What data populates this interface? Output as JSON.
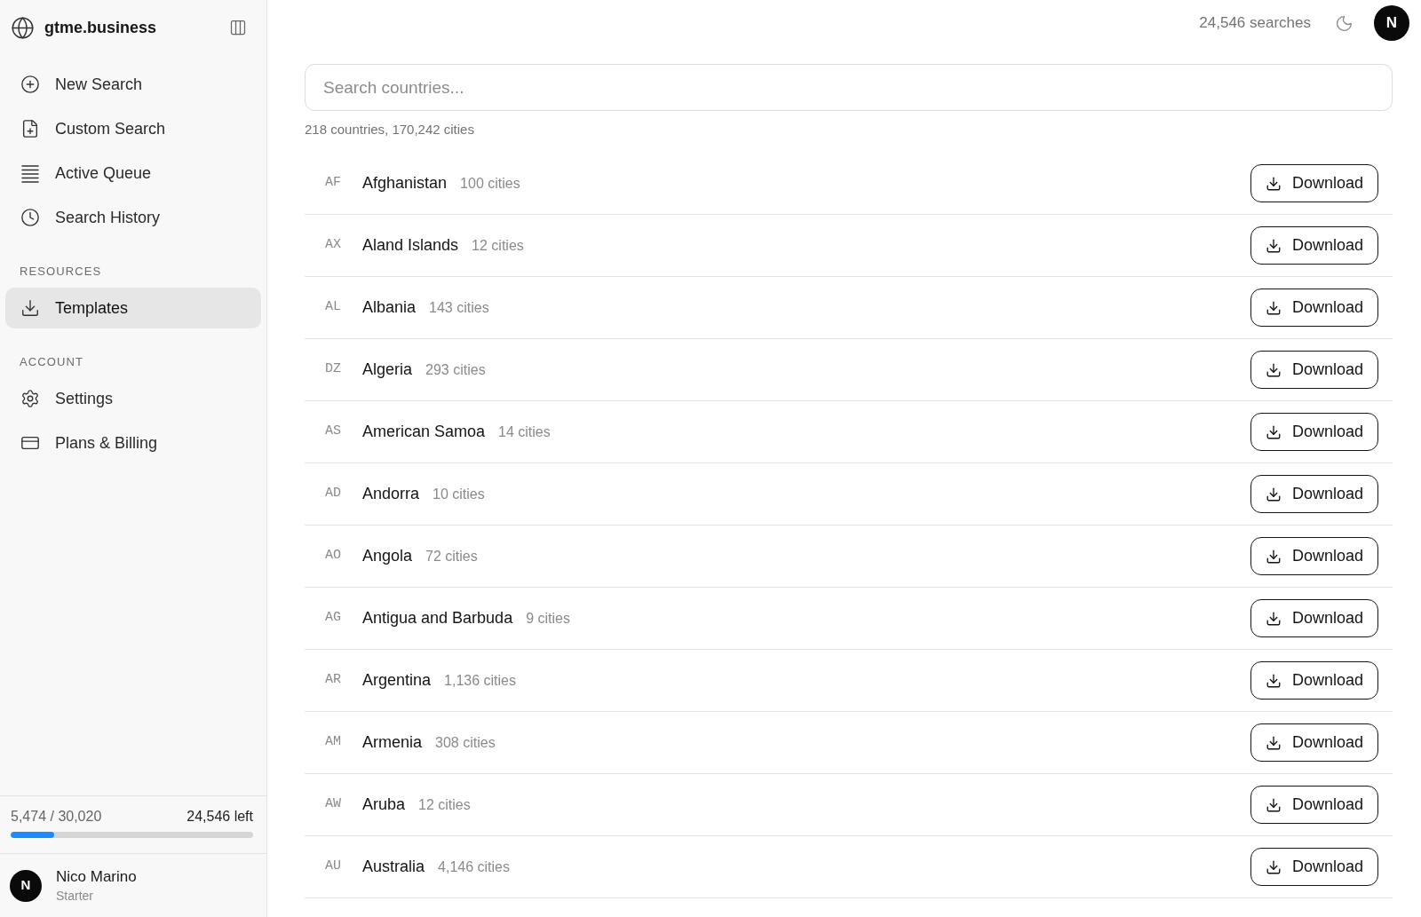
{
  "sidebar": {
    "brand": "gtme.business",
    "sections": [
      {
        "items": [
          {
            "label": "New Search",
            "selected": false
          },
          {
            "label": "Custom Search",
            "selected": false
          },
          {
            "label": "Active Queue",
            "selected": false
          },
          {
            "label": "Search History",
            "selected": false
          }
        ]
      },
      {
        "heading": "RESOURCES",
        "items": [
          {
            "label": "Templates",
            "selected": true
          }
        ]
      },
      {
        "heading": "ACCOUNT",
        "items": [
          {
            "label": "Settings",
            "selected": false
          },
          {
            "label": "Plans & Billing",
            "selected": false
          }
        ]
      }
    ],
    "usage": {
      "used": "5,474 / 30,020",
      "left": "24,546 left",
      "level": 0.18
    },
    "user": {
      "avatar": "N",
      "name": "Nico Marino",
      "plan": "Starter"
    }
  },
  "topbar": {
    "searches": "24,546 searches",
    "avatar": "N"
  },
  "search": {
    "placeholder": "Search countries..."
  },
  "summary": "218 countries, 170,242 cities",
  "countries": [
    {
      "code": "AF",
      "name": "Afghanistan",
      "cities": "100 cities",
      "button": "Download"
    },
    {
      "code": "AX",
      "name": "Aland Islands",
      "cities": "12 cities",
      "button": "Download"
    },
    {
      "code": "AL",
      "name": "Albania",
      "cities": "143 cities",
      "button": "Download"
    },
    {
      "code": "DZ",
      "name": "Algeria",
      "cities": "293 cities",
      "button": "Download"
    },
    {
      "code": "AS",
      "name": "American Samoa",
      "cities": "14 cities",
      "button": "Download"
    },
    {
      "code": "AD",
      "name": "Andorra",
      "cities": "10 cities",
      "button": "Download"
    },
    {
      "code": "AO",
      "name": "Angola",
      "cities": "72 cities",
      "button": "Download"
    },
    {
      "code": "AG",
      "name": "Antigua and Barbuda",
      "cities": "9 cities",
      "button": "Download"
    },
    {
      "code": "AR",
      "name": "Argentina",
      "cities": "1,136 cities",
      "button": "Download"
    },
    {
      "code": "AM",
      "name": "Armenia",
      "cities": "308 cities",
      "button": "Download"
    },
    {
      "code": "AW",
      "name": "Aruba",
      "cities": "12 cities",
      "button": "Download"
    },
    {
      "code": "AU",
      "name": "Australia",
      "cities": "4,146 cities",
      "button": "Download"
    }
  ]
}
